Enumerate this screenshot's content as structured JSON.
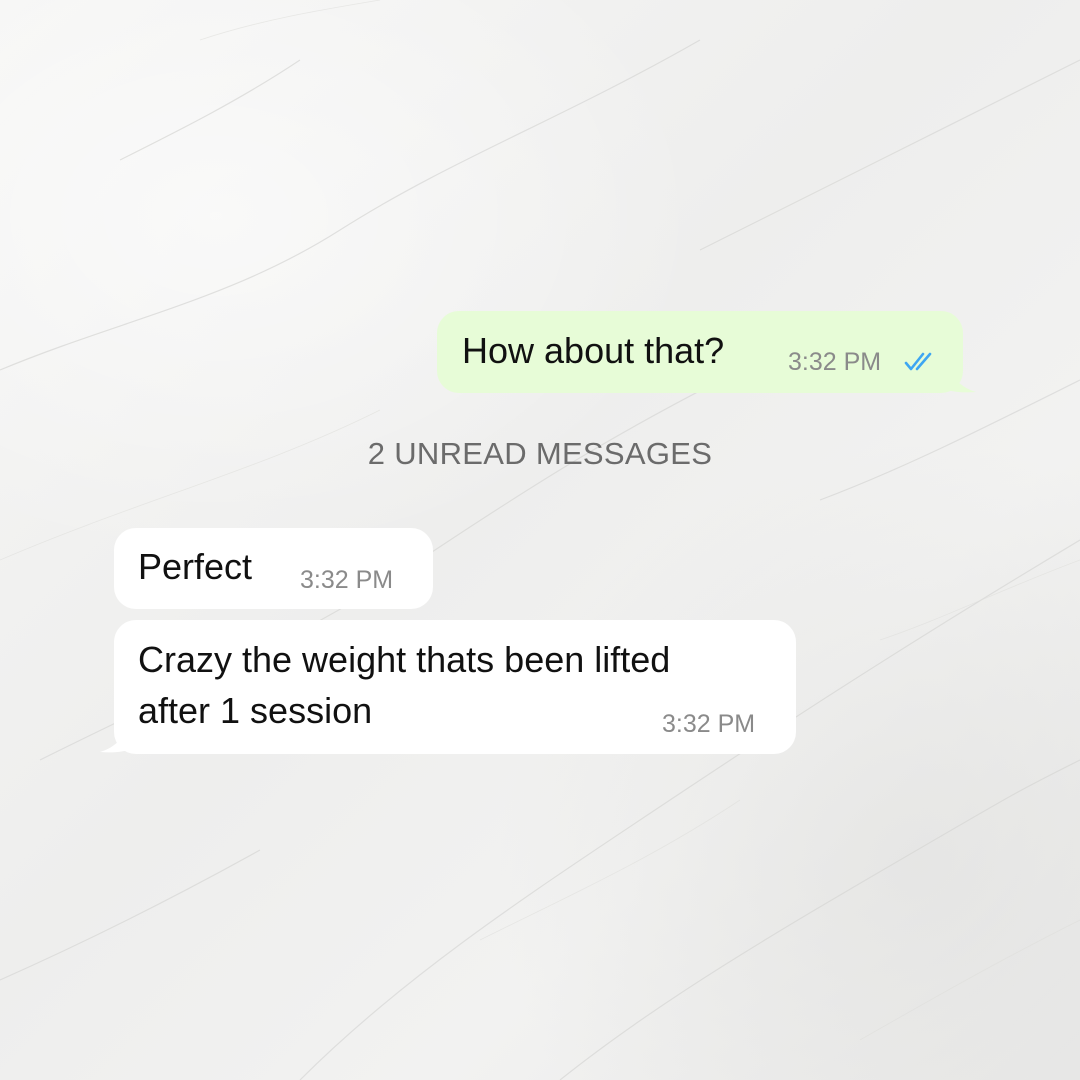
{
  "chat": {
    "messages": [
      {
        "direction": "outgoing",
        "text": "How about that?",
        "time": "3:32 PM",
        "status_icon": "double-check-read-icon"
      },
      {
        "direction": "incoming",
        "text": "Perfect",
        "time": "3:32 PM"
      },
      {
        "direction": "incoming",
        "text_lines": [
          "Crazy the weight thats been lifted",
          "after 1 session"
        ],
        "time": "3:32 PM"
      }
    ],
    "unread_divider": "2 UNREAD MESSAGES"
  },
  "colors": {
    "outgoing_bubble": "#e7fcd7",
    "incoming_bubble": "#ffffff",
    "read_ticks": "#3ea6f2",
    "timestamp": "#8a8a8a"
  }
}
